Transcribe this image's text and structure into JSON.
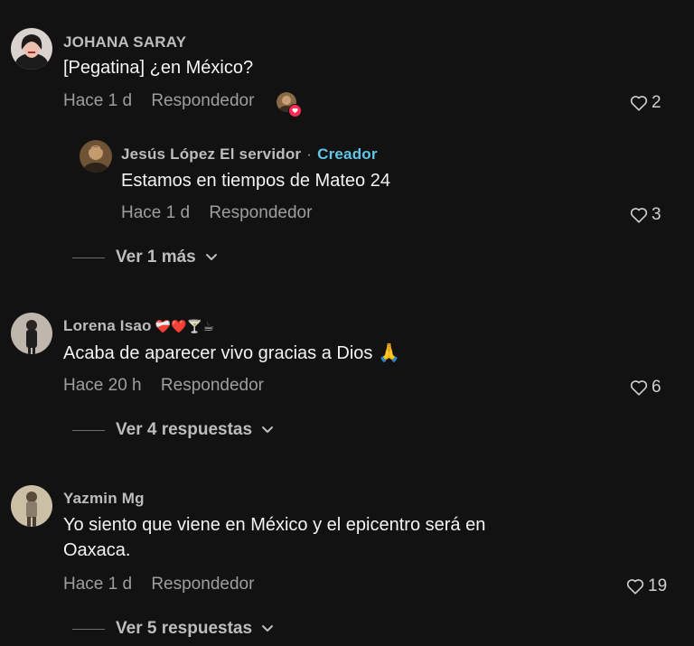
{
  "comments": [
    {
      "username": "JOHANA SARAY",
      "text": "[Pegatina] ¿en México?",
      "time": "Hace 1 d",
      "reply_label": "Respondedor",
      "likes": "2",
      "replies": [
        {
          "username": "Jesús López El servidor",
          "separator": "·",
          "badge": "Creador",
          "text": "Estamos en tiempos de Mateo 24",
          "time": "Hace 1 d",
          "reply_label": "Respondedor",
          "likes": "3"
        }
      ],
      "more_label": "Ver 1 más"
    },
    {
      "username": "Lorena Isao",
      "username_emojis": "❤️‍🩹❤️🍸☕",
      "text": "Acaba de aparecer vivo gracias a Dios 🙏",
      "time": "Hace 20 h",
      "reply_label": "Respondedor",
      "likes": "6",
      "more_label": "Ver 4 respuestas"
    },
    {
      "username": "Yazmin Mg",
      "text_line1": "Yo siento que viene en México y el epicentro será en",
      "text_line2": "Oaxaca.",
      "time": "Hace 1 d",
      "reply_label": "Respondedor",
      "likes": "19",
      "more_label": "Ver 5 respuestas"
    }
  ],
  "colors": {
    "background": "#121212",
    "creator_badge": "#62c5e6",
    "like_heart_badge": "#fe2c55"
  }
}
